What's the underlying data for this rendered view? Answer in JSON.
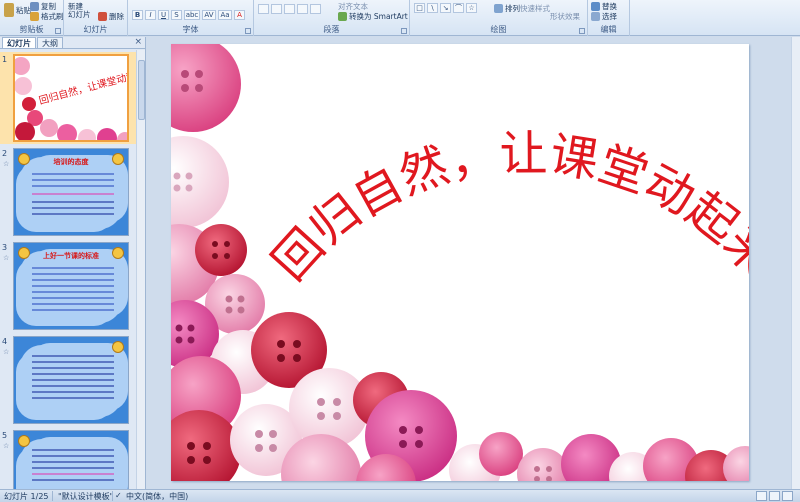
{
  "ribbon": {
    "groups": {
      "clipboard": {
        "label": "剪贴板",
        "paste": "粘贴",
        "copy": "复制",
        "format_painter": "格式刷"
      },
      "slides": {
        "label": "幻灯片",
        "new_slide": "新建\n幻灯片",
        "delete": "删除"
      },
      "font": {
        "label": "字体",
        "buttons": [
          "B",
          "I",
          "U",
          "S",
          "abc",
          "AV",
          "Aa",
          "A"
        ]
      },
      "paragraph": {
        "label": "段落",
        "convert_smartart": "转换为 SmartArt",
        "align_text": "对齐文本"
      },
      "drawing": {
        "label": "绘图",
        "arrange": "排列",
        "quick_styles": "快速样式",
        "shape_effects": "形状效果"
      },
      "editing": {
        "label": "编辑",
        "replace": "替换",
        "select": "选择"
      }
    }
  },
  "left_pane": {
    "tabs": [
      "幻灯片",
      "大纲"
    ],
    "close_glyph": "×",
    "slides": [
      {
        "number": "1",
        "anim": "",
        "title": "回归自然，让课堂动起来"
      },
      {
        "number": "2",
        "anim": "☆",
        "title": "培训的态度"
      },
      {
        "number": "3",
        "anim": "☆",
        "title": "上好一节课的标准"
      },
      {
        "number": "4",
        "anim": "☆",
        "title": ""
      },
      {
        "number": "5",
        "anim": "☆",
        "title": ""
      }
    ]
  },
  "slide": {
    "title": "回归自然，让课堂动起来"
  },
  "statusbar": {
    "slide_index": "幻灯片 1/25",
    "theme": "\"默认设计模板\"",
    "language": "中文(简体，中国)"
  },
  "colors": {
    "title_red": "#e0181f",
    "selected_thumb_border": "#f0a040",
    "ribbon_bg": "#d6e4f4"
  }
}
